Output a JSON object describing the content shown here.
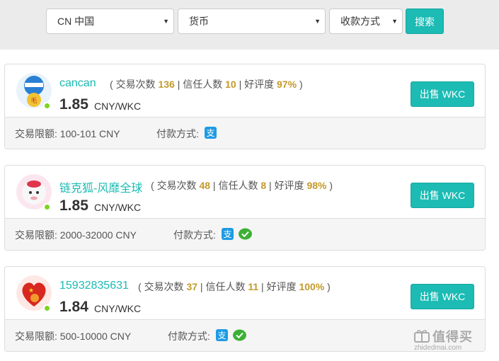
{
  "filters": {
    "country": "CN 中国",
    "currency": "货币",
    "payment_method": "收款方式",
    "search_label": "搜索"
  },
  "labels": {
    "trades": "交易次数",
    "trust": "信任人数",
    "rating": "好评度",
    "sep": "|",
    "open_paren": "(",
    "close_paren": ")",
    "unit": "CNY/WKC",
    "limit_prefix": "交易限额:",
    "pay_method": "付款方式:",
    "sell": "出售 WKC"
  },
  "offers": [
    {
      "username": "cancan",
      "trades": "136",
      "trust": "10",
      "rating": "97%",
      "price": "1.85",
      "limit": "100-101 CNY",
      "payments": [
        "alipay-icon"
      ]
    },
    {
      "username": "链克狐-风靡全球",
      "trades": "48",
      "trust": "8",
      "rating": "98%",
      "price": "1.85",
      "limit": "2000-32000 CNY",
      "payments": [
        "alipay-icon",
        "wechat-pay-icon"
      ]
    },
    {
      "username": "15932835631",
      "trades": "37",
      "trust": "11",
      "rating": "100%",
      "price": "1.84",
      "limit": "500-10000 CNY",
      "payments": [
        "alipay-icon",
        "wechat-pay-icon"
      ]
    }
  ],
  "watermark": {
    "title": "值得买",
    "subtitle": "zhidedmai.com"
  },
  "colors": {
    "accent": "#1cbbb4",
    "stat_number": "#c49a2c",
    "online": "#7ed321",
    "alipay": "#1e9be3",
    "wechat": "#3cb034"
  }
}
